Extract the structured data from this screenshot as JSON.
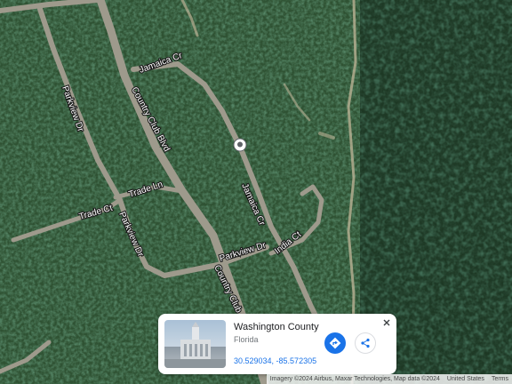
{
  "map": {
    "type": "satellite",
    "road_labels": {
      "jamaica_cr_top": "Jamaica Cr",
      "jamaica_cr_right": "Jamaica Cr",
      "country_club_blvd": "Country Club Blvd",
      "country_club_blvd_lower": "Country Club",
      "parkview_dr_left": "Parkview Dr",
      "parkview_dr_mid": "Parkview Dr",
      "parkview_dr_bottom": "Parkview Dr",
      "trade_ln": "Trade Ln",
      "trade_ct": "Trade Ct",
      "india_ct": "India Ct"
    },
    "pin_icon": "location-pin-icon"
  },
  "place_card": {
    "name": "Washington County",
    "region": "Florida",
    "coordinates": "30.529034, -85.572305",
    "directions_icon": "directions-icon",
    "share_icon": "share-icon",
    "close_icon": "close-icon",
    "accent_color": "#1a73e8"
  },
  "attribution": {
    "imagery": "Imagery ©2024 Airbus, Maxar Technologies, Map data ©2024",
    "country": "United States",
    "terms": "Terms"
  }
}
